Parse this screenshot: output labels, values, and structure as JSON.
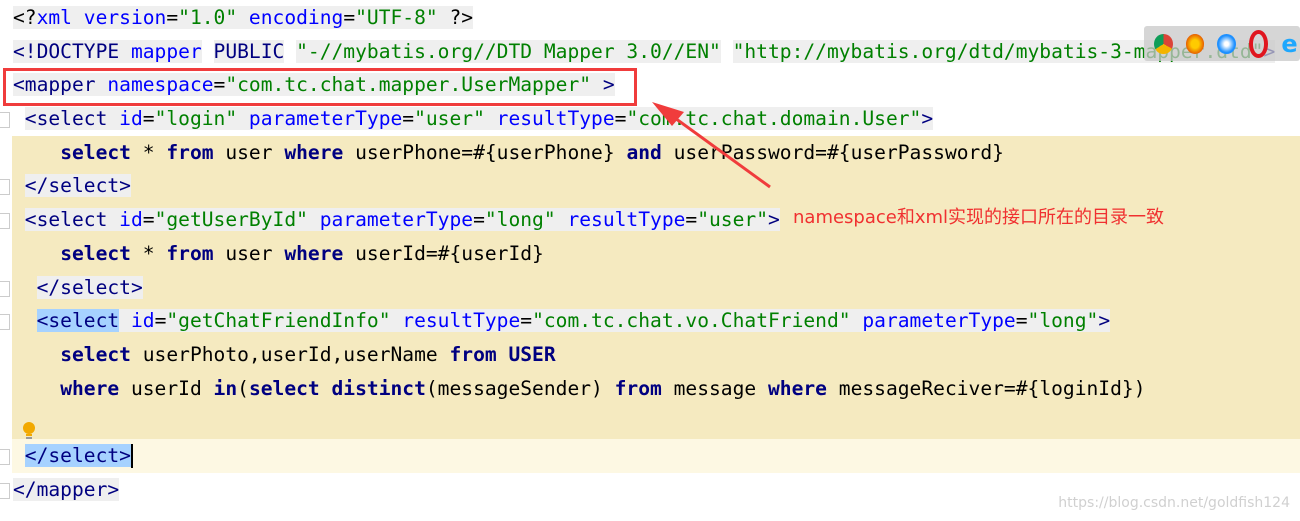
{
  "editor": {
    "lines": [
      {
        "indent": 0,
        "bg": "none",
        "tokens": [
          {
            "t": "<?",
            "k": "pi",
            "g": 1
          },
          {
            "t": "xml version",
            "k": "attr",
            "g": 1
          },
          {
            "t": "=",
            "k": "txt",
            "g": 1
          },
          {
            "t": "\"1.0\"",
            "k": "str",
            "g": 1
          },
          {
            "t": " encoding",
            "k": "attr",
            "g": 1
          },
          {
            "t": "=",
            "k": "txt",
            "g": 1
          },
          {
            "t": "\"UTF-8\"",
            "k": "str",
            "g": 1
          },
          {
            "t": " ?>",
            "k": "pi",
            "g": 1
          }
        ]
      },
      {
        "indent": 0,
        "bg": "none",
        "tokens": [
          {
            "t": "<!DOCTYPE ",
            "k": "tag",
            "g": 1
          },
          {
            "t": "mapper",
            "k": "attr",
            "g": 1
          },
          {
            "t": " ",
            "k": "txt"
          },
          {
            "t": "PUBLIC",
            "k": "tag",
            "g": 1
          },
          {
            "t": " ",
            "k": "txt"
          },
          {
            "t": "\"-//mybatis.org//DTD Mapper 3.0//EN\"",
            "k": "str",
            "g": 1
          },
          {
            "t": " ",
            "k": "txt"
          },
          {
            "t": "\"http://mybatis.org/dtd/mybatis-3-mapper.dtd\"",
            "k": "str",
            "g": 1
          },
          {
            "t": ">",
            "k": "tag",
            "g": 1
          }
        ]
      },
      {
        "indent": 0,
        "bg": "none",
        "tokens": [
          {
            "t": "<mapper ",
            "k": "tag",
            "g": 1
          },
          {
            "t": "namespace",
            "k": "attr",
            "g": 1
          },
          {
            "t": "=",
            "k": "txt",
            "g": 1
          },
          {
            "t": "\"com.tc.chat.mapper.UserMapper\"",
            "k": "str",
            "g": 1
          },
          {
            "t": " >",
            "k": "tag",
            "g": 1
          }
        ]
      },
      {
        "indent": 1,
        "bg": "none",
        "tokens": [
          {
            "t": "<select ",
            "k": "tag",
            "g": 1
          },
          {
            "t": "id",
            "k": "attr",
            "g": 1
          },
          {
            "t": "=",
            "k": "txt",
            "g": 1
          },
          {
            "t": "\"login\"",
            "k": "str",
            "g": 1
          },
          {
            "t": " parameterType",
            "k": "attr",
            "g": 1
          },
          {
            "t": "=",
            "k": "txt",
            "g": 1
          },
          {
            "t": "\"user\"",
            "k": "str",
            "g": 1
          },
          {
            "t": " resultType",
            "k": "attr",
            "g": 1
          },
          {
            "t": "=",
            "k": "txt",
            "g": 1
          },
          {
            "t": "\"com.tc.chat.domain.User\"",
            "k": "str",
            "g": 1
          },
          {
            "t": ">",
            "k": "tag",
            "g": 1
          }
        ]
      },
      {
        "indent": 4,
        "bg": "yellow",
        "tokens": [
          {
            "t": "select",
            "k": "kw"
          },
          {
            "t": " * ",
            "k": "txt"
          },
          {
            "t": "from",
            "k": "kw"
          },
          {
            "t": " user ",
            "k": "txt"
          },
          {
            "t": "where",
            "k": "kw"
          },
          {
            "t": " userPhone=#{userPhone} ",
            "k": "txt"
          },
          {
            "t": "and",
            "k": "kw"
          },
          {
            "t": " userPassword=#{userPassword}",
            "k": "txt"
          }
        ]
      },
      {
        "indent": 1,
        "bg": "yellow",
        "tokens": [
          {
            "t": "</select>",
            "k": "tag",
            "g": 1
          }
        ]
      },
      {
        "indent": 1,
        "bg": "yellow",
        "tokens": [
          {
            "t": "<select ",
            "k": "tag",
            "g": 1
          },
          {
            "t": "id",
            "k": "attr",
            "g": 1
          },
          {
            "t": "=",
            "k": "txt",
            "g": 1
          },
          {
            "t": "\"getUserById\"",
            "k": "str",
            "g": 1
          },
          {
            "t": " parameterType",
            "k": "attr",
            "g": 1
          },
          {
            "t": "=",
            "k": "txt",
            "g": 1
          },
          {
            "t": "\"long\"",
            "k": "str",
            "g": 1
          },
          {
            "t": " resultType",
            "k": "attr",
            "g": 1
          },
          {
            "t": "=",
            "k": "txt",
            "g": 1
          },
          {
            "t": "\"user\"",
            "k": "str",
            "g": 1
          },
          {
            "t": ">",
            "k": "tag",
            "g": 1
          }
        ]
      },
      {
        "indent": 4,
        "bg": "yellow",
        "tokens": [
          {
            "t": "select",
            "k": "kw"
          },
          {
            "t": " * ",
            "k": "txt"
          },
          {
            "t": "from",
            "k": "kw"
          },
          {
            "t": " user ",
            "k": "txt"
          },
          {
            "t": "where",
            "k": "kw"
          },
          {
            "t": " userId=#{userId}",
            "k": "txt"
          }
        ]
      },
      {
        "indent": 2,
        "bg": "yellow",
        "tokens": [
          {
            "t": "</select>",
            "k": "tag",
            "g": 1
          }
        ]
      },
      {
        "indent": 2,
        "bg": "yellow",
        "tokens": [
          {
            "t": "<select",
            "k": "tag",
            "s": 1
          },
          {
            "t": " id",
            "k": "attr",
            "g": 1
          },
          {
            "t": "=",
            "k": "txt",
            "g": 1
          },
          {
            "t": "\"getChatFriendInfo\"",
            "k": "str",
            "g": 1
          },
          {
            "t": " resultType",
            "k": "attr",
            "g": 1
          },
          {
            "t": "=",
            "k": "txt",
            "g": 1
          },
          {
            "t": "\"com.tc.chat.vo.ChatFriend\"",
            "k": "str",
            "g": 1
          },
          {
            "t": " parameterType",
            "k": "attr",
            "g": 1
          },
          {
            "t": "=",
            "k": "txt",
            "g": 1
          },
          {
            "t": "\"long\"",
            "k": "str",
            "g": 1
          },
          {
            "t": ">",
            "k": "tag",
            "g": 1
          }
        ]
      },
      {
        "indent": 4,
        "bg": "yellow",
        "tokens": [
          {
            "t": "select",
            "k": "kw"
          },
          {
            "t": " userPhoto,userId,userName ",
            "k": "txt"
          },
          {
            "t": "from",
            "k": "kw"
          },
          {
            "t": " ",
            "k": "txt"
          },
          {
            "t": "USER",
            "k": "kw"
          }
        ]
      },
      {
        "indent": 4,
        "bg": "yellow",
        "tokens": [
          {
            "t": "where",
            "k": "kw"
          },
          {
            "t": " userId ",
            "k": "txt"
          },
          {
            "t": "in",
            "k": "kw"
          },
          {
            "t": "(",
            "k": "txt"
          },
          {
            "t": "select distinct",
            "k": "kw"
          },
          {
            "t": "(messageSender) ",
            "k": "txt"
          },
          {
            "t": "from",
            "k": "kw"
          },
          {
            "t": " message ",
            "k": "txt"
          },
          {
            "t": "where",
            "k": "kw"
          },
          {
            "t": " messageReciver=#{loginId})",
            "k": "txt"
          }
        ]
      },
      {
        "indent": 0,
        "bg": "yellow",
        "tokens": []
      },
      {
        "indent": 1,
        "bg": "current",
        "cursor": true,
        "tokens": [
          {
            "t": "</select>",
            "k": "tag",
            "s": 1
          }
        ]
      },
      {
        "indent": 0,
        "bg": "none",
        "tokens": [
          {
            "t": "</mapper>",
            "k": "tag",
            "g": 1
          }
        ]
      }
    ]
  },
  "annotation": {
    "text": "namespace和xml实现的接口所在的目录一致",
    "color": "#f03c3c"
  },
  "browser_icons": [
    "chrome-icon",
    "firefox-icon",
    "safari-icon",
    "opera-icon",
    "ie-icon"
  ],
  "watermark": "https://blog.csdn.net/goldfish124",
  "colors": {
    "tag": "#000080",
    "attribute": "#0000ff",
    "string": "#008000",
    "block_highlight": "#f5eac0",
    "current_line": "#fdf8e3",
    "selection": "#a6d2ff"
  }
}
